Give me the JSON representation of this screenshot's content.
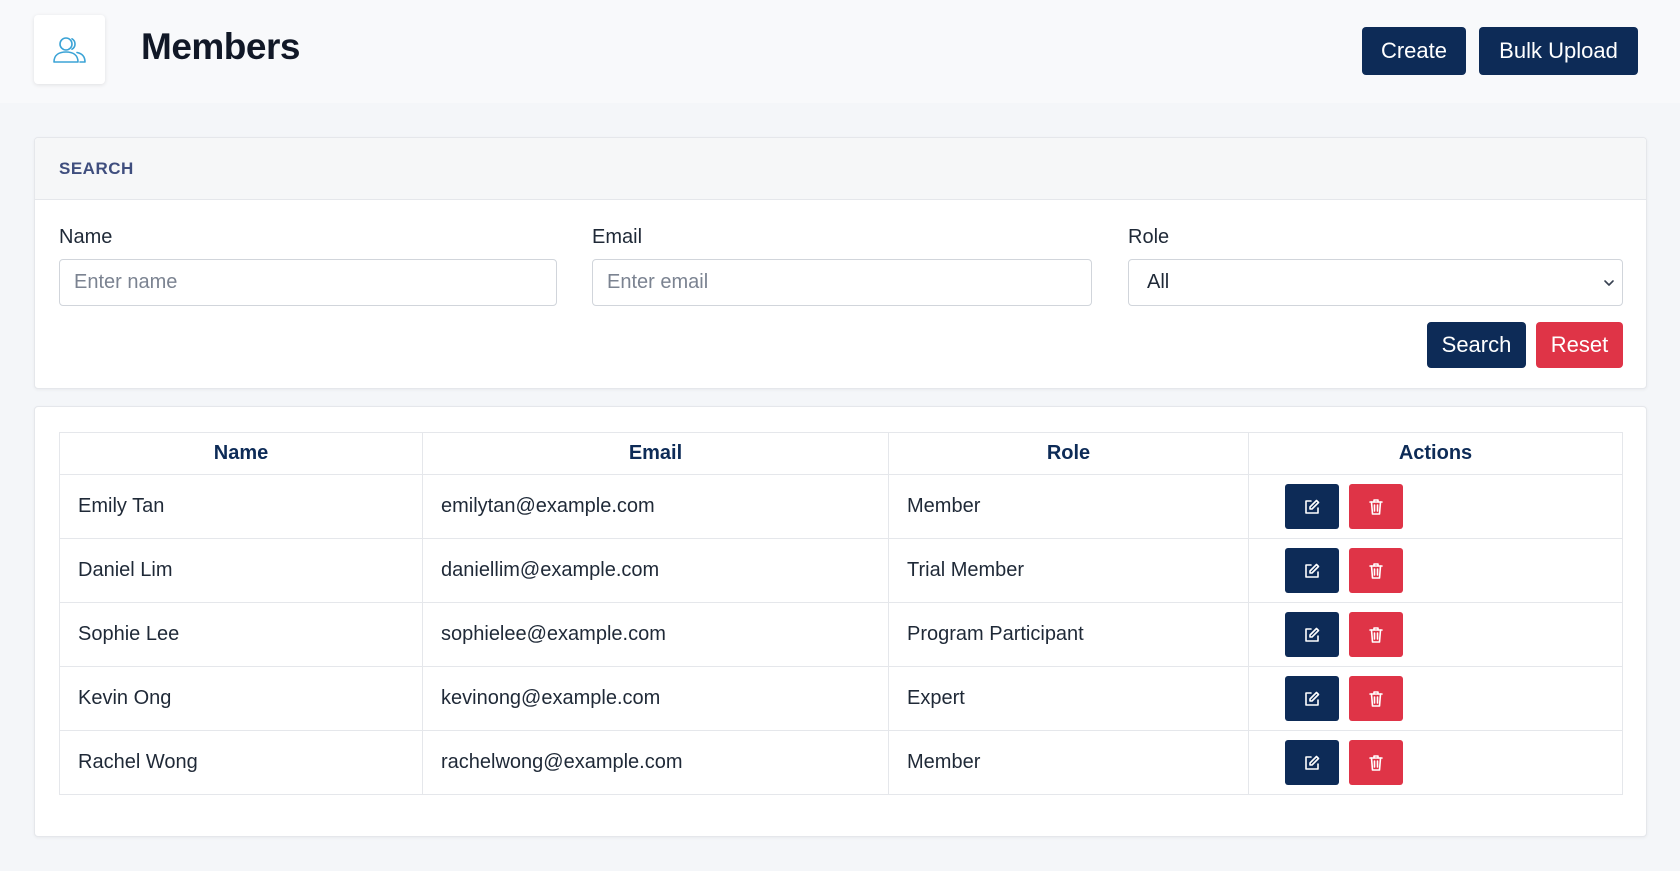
{
  "header": {
    "title": "Members",
    "logo_icon": "users-icon",
    "create_label": "Create",
    "bulk_upload_label": "Bulk Upload"
  },
  "search": {
    "section_title": "SEARCH",
    "name_label": "Name",
    "name_placeholder": "Enter name",
    "name_value": "",
    "email_label": "Email",
    "email_placeholder": "Enter email",
    "email_value": "",
    "role_label": "Role",
    "role_selected": "All",
    "search_label": "Search",
    "reset_label": "Reset"
  },
  "table": {
    "columns": [
      "Name",
      "Email",
      "Role",
      "Actions"
    ],
    "rows": [
      {
        "name": "Emily Tan",
        "email": "emilytan@example.com",
        "role": "Member"
      },
      {
        "name": "Daniel Lim",
        "email": "daniellim@example.com",
        "role": "Trial Member"
      },
      {
        "name": "Sophie Lee",
        "email": "sophielee@example.com",
        "role": "Program Participant"
      },
      {
        "name": "Kevin Ong",
        "email": "kevinong@example.com",
        "role": "Expert"
      },
      {
        "name": "Rachel Wong",
        "email": "rachelwong@example.com",
        "role": "Member"
      }
    ],
    "edit_icon": "edit-icon",
    "delete_icon": "trash-icon"
  },
  "colors": {
    "primary": "#0d2b57",
    "danger": "#df3447",
    "section_title": "#3f4e7e",
    "background": "#f4f6f9"
  }
}
